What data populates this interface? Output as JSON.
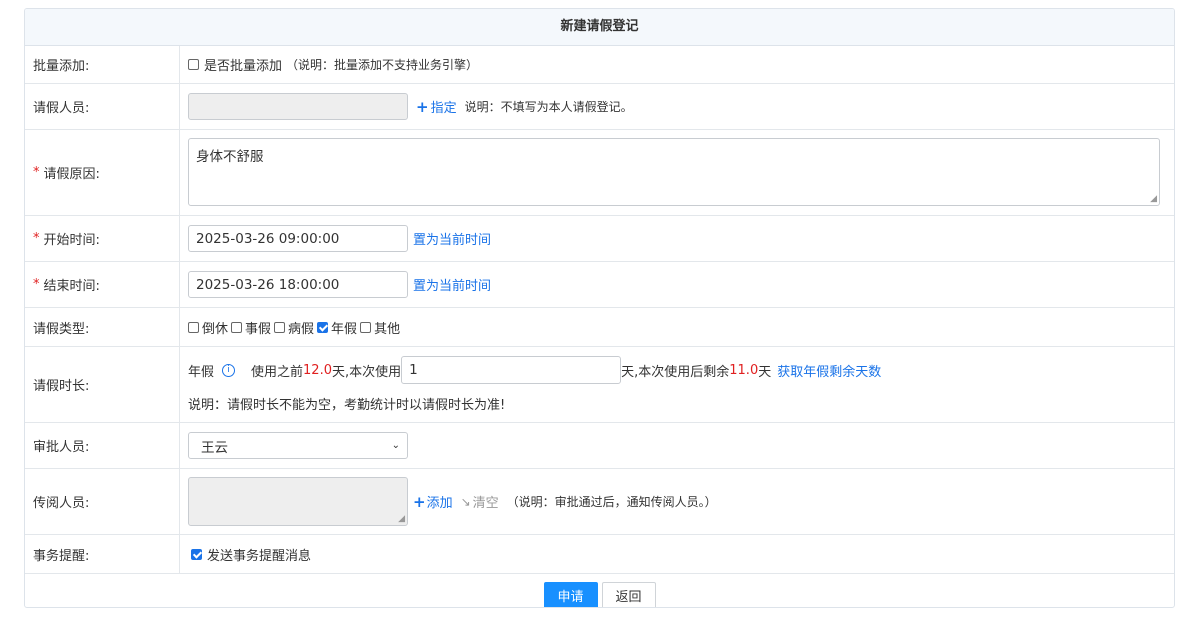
{
  "form": {
    "title": "新建请假登记",
    "batch": {
      "label": "批量添加:",
      "checkbox_label": "是否批量添加",
      "note": "（说明：批量添加不支持业务引擎）"
    },
    "person": {
      "label": "请假人员:",
      "assign_label": "指定",
      "note": "说明：不填写为本人请假登记。"
    },
    "reason": {
      "label": "请假原因:",
      "value": "身体不舒服"
    },
    "start": {
      "label": "开始时间:",
      "value": "2025-03-26 09:00:00",
      "now_label": "置为当前时间"
    },
    "end": {
      "label": "结束时间:",
      "value": "2025-03-26 18:00:00",
      "now_label": "置为当前时间"
    },
    "leave_type": {
      "label": "请假类型:",
      "options": [
        {
          "label": "倒休",
          "checked": false
        },
        {
          "label": "事假",
          "checked": false
        },
        {
          "label": "病假",
          "checked": false
        },
        {
          "label": "年假",
          "checked": true
        },
        {
          "label": "其他",
          "checked": false
        }
      ]
    },
    "duration": {
      "label": "请假时长:",
      "type_label": "年假",
      "before_prefix": "使用之前",
      "before_value": "12.0",
      "before_suffix": "天,本次使用",
      "value": "1",
      "after_prefix": "天,本次使用后剩余",
      "after_value": "11.0",
      "after_suffix": "天",
      "fetch_label": "获取年假剩余天数",
      "note": "说明：请假时长不能为空，考勤统计时以请假时长为准!"
    },
    "approver": {
      "label": "审批人员:",
      "selected": "王云"
    },
    "cc": {
      "label": "传阅人员:",
      "add_label": "添加",
      "clear_label": "清空",
      "note": "（说明：审批通过后，通知传阅人员。）"
    },
    "reminder": {
      "label": "事务提醒:",
      "checkbox_label": "发送事务提醒消息",
      "checked": true
    },
    "buttons": {
      "submit": "申请",
      "back": "返回"
    }
  },
  "colors": {
    "accent": "#1a73e8",
    "primary_button": "#1890ff",
    "required": "#e02020"
  }
}
